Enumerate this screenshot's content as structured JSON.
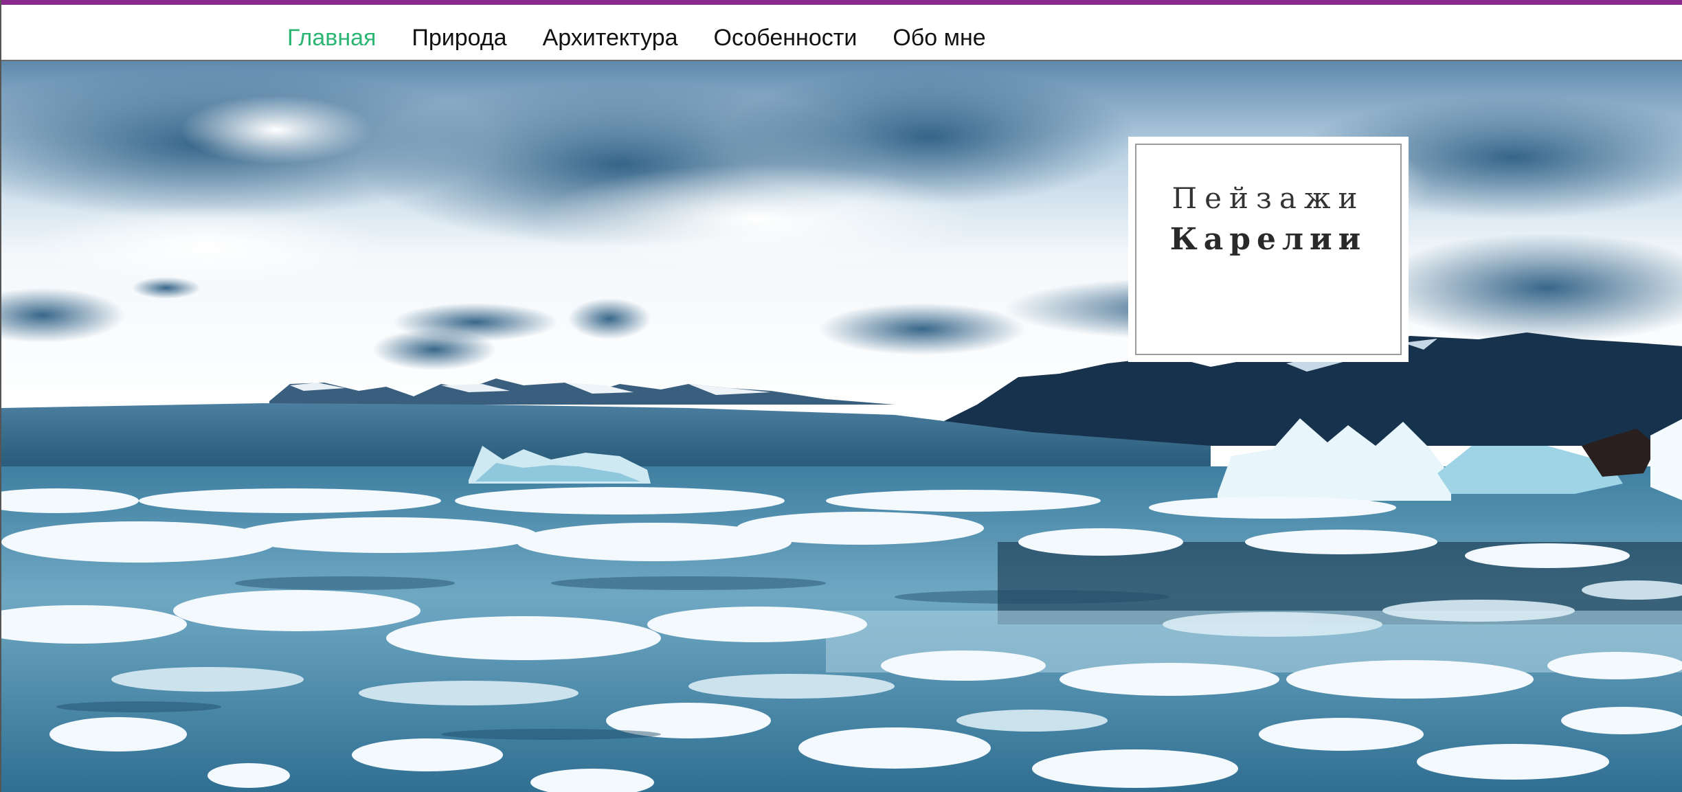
{
  "colors": {
    "top_accent": "#8a2a8c",
    "nav_active": "#2bb673",
    "nav_text": "#111111"
  },
  "nav": {
    "items": [
      {
        "label": "Главная",
        "active": true
      },
      {
        "label": "Природа",
        "active": false
      },
      {
        "label": "Архитектура",
        "active": false
      },
      {
        "label": "Особенности",
        "active": false
      },
      {
        "label": "Обо мне",
        "active": false
      }
    ]
  },
  "hero": {
    "image_alt": "icebergs-landscape-photo"
  },
  "title_card": {
    "line1": "Пейзажи",
    "line2": "Карелии"
  }
}
